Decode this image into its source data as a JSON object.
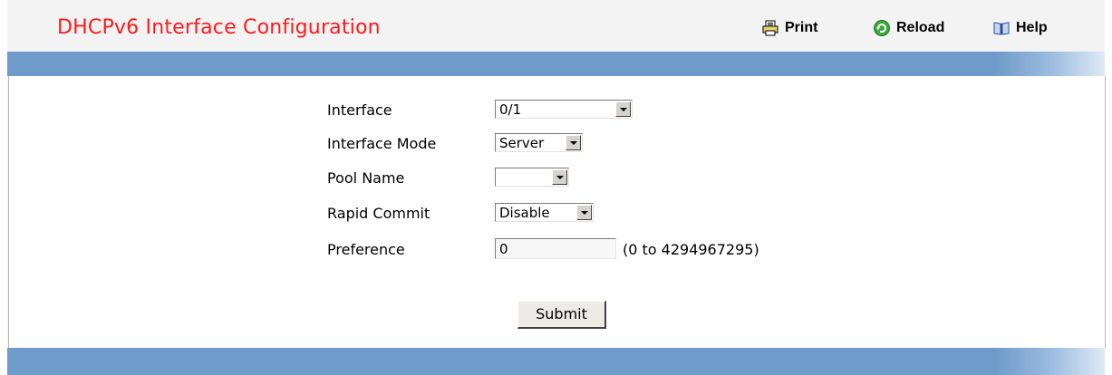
{
  "page": {
    "title": "DHCPv6 Interface Configuration"
  },
  "toolbar": {
    "print_label": "Print",
    "reload_label": "Reload",
    "help_label": "Help"
  },
  "form": {
    "interface": {
      "label": "Interface",
      "value": "0/1"
    },
    "interface_mode": {
      "label": "Interface Mode",
      "value": "Server"
    },
    "pool_name": {
      "label": "Pool Name",
      "value": ""
    },
    "rapid_commit": {
      "label": "Rapid Commit",
      "value": "Disable"
    },
    "preference": {
      "label": "Preference",
      "value": "0",
      "hint": "(0 to 4294967295)"
    },
    "submit_label": "Submit"
  },
  "colors": {
    "title": "#ff1a1a",
    "band": "#6e9bc9"
  }
}
